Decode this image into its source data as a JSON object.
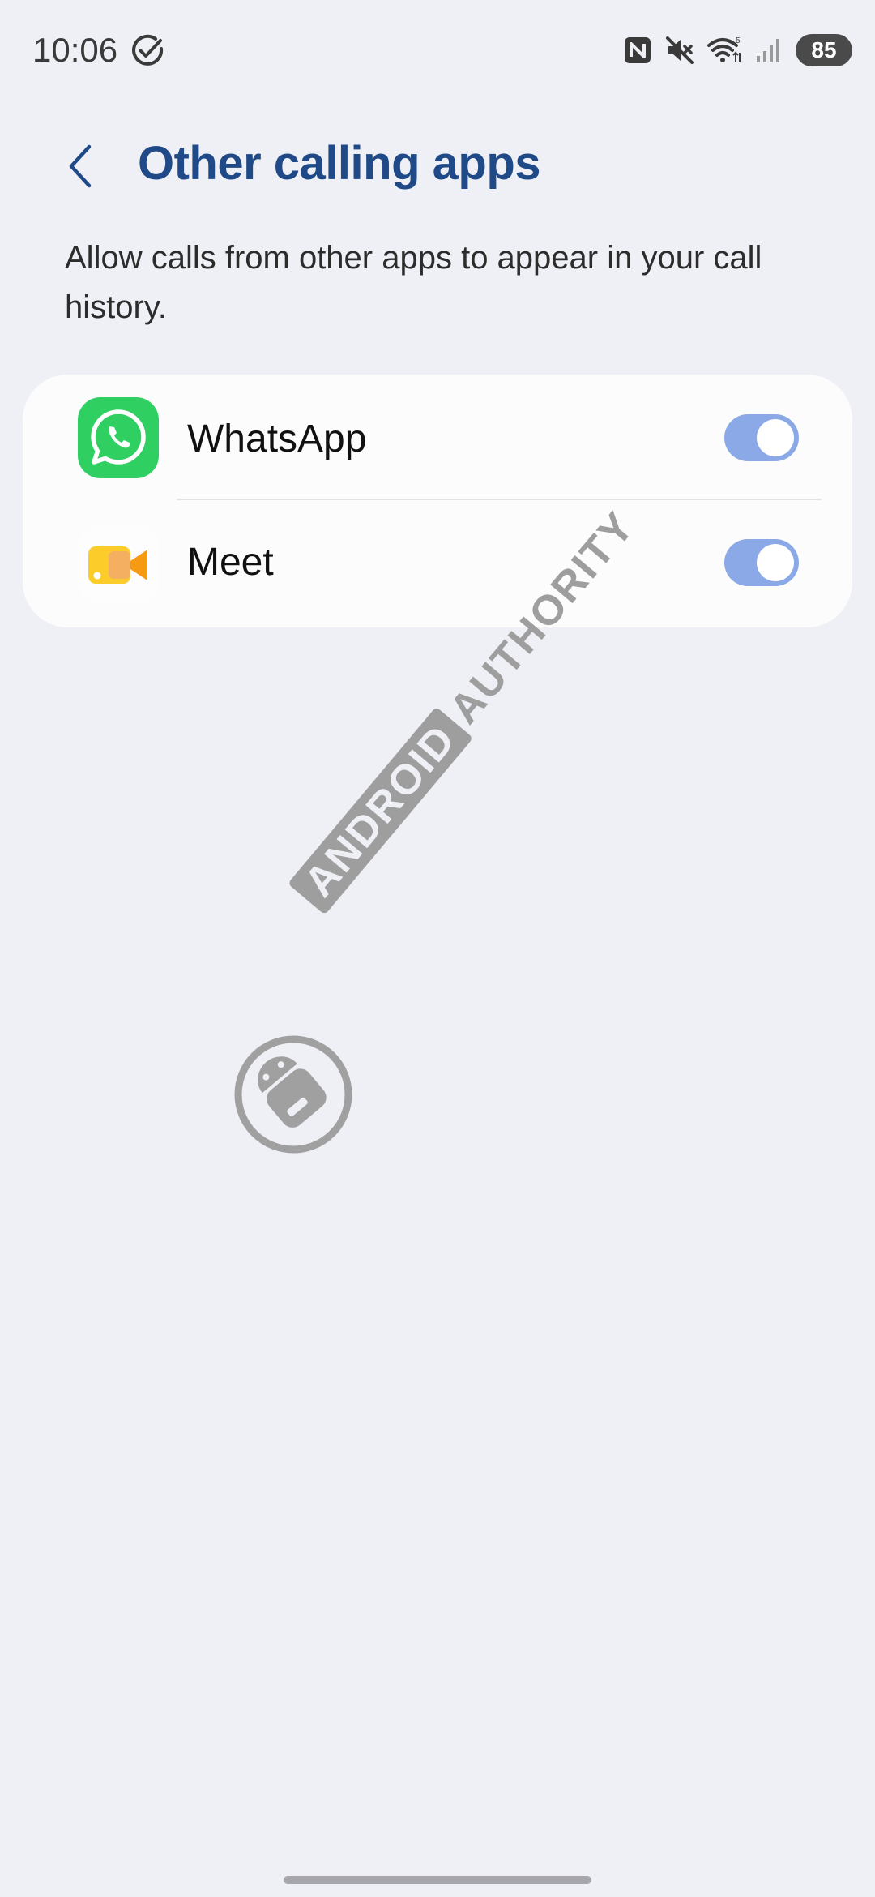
{
  "status_bar": {
    "time": "10:06",
    "battery": "85",
    "icons": [
      "check-circle-icon",
      "nfc-icon",
      "mute-icon",
      "wifi-icon",
      "signal-icon"
    ]
  },
  "header": {
    "title": "Other calling apps",
    "back_icon": "chevron-left-icon"
  },
  "description": "Allow calls from other apps to appear in your call history.",
  "apps": [
    {
      "label": "WhatsApp",
      "icon": "whatsapp-icon",
      "enabled": true
    },
    {
      "label": "Meet",
      "icon": "meet-icon",
      "enabled": true
    }
  ],
  "watermark": {
    "boxed": "ANDROID",
    "plain": "AUTHORITY"
  },
  "colors": {
    "title": "#1f4987",
    "toggle_on": "#8aa9e6",
    "background": "#eff0f5",
    "whatsapp_green": "#2fcf61"
  }
}
